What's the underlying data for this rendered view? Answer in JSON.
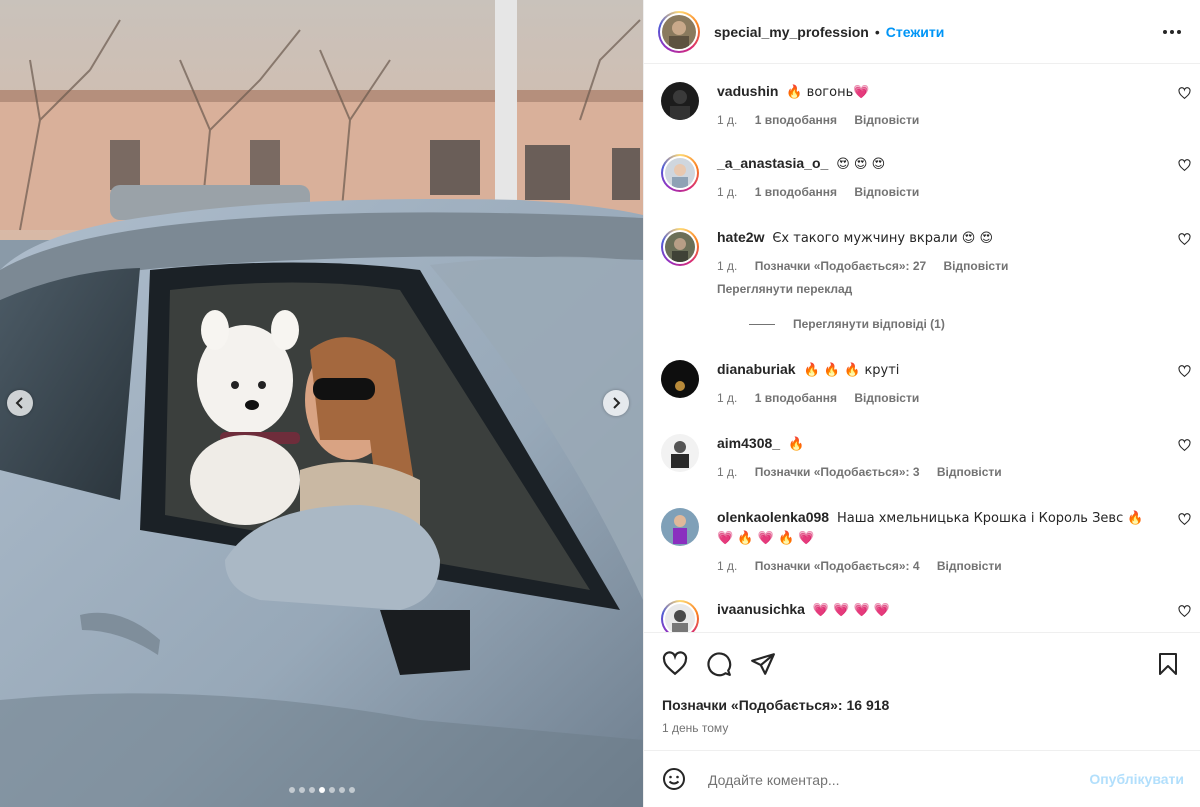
{
  "colors": {
    "accent": "#0095f6",
    "muted": "#737373",
    "text": "#262626",
    "post_disabled": "#b2dffc",
    "heart": "#ed4956"
  },
  "header": {
    "username": "special_my_profession",
    "separator": "•",
    "follow_label": "Стежити",
    "more_icon": "more-horizontal-icon"
  },
  "comments": [
    {
      "username": "vadushin",
      "text": "🔥 вогонь💗",
      "time": "1 д.",
      "likes": "1 вподобання",
      "reply": "Відповісти"
    },
    {
      "username": "_a_anastasia_o_",
      "text": "😍 😍 😍",
      "time": "1 д.",
      "likes": "1 вподобання",
      "reply": "Відповісти"
    },
    {
      "username": "hate2w",
      "text": "Єх такого мужчину вкрали 😍 😍",
      "time": "1 д.",
      "likes": "Позначки «Подобається»: 27",
      "reply": "Відповісти",
      "translate": "Переглянути переклад",
      "view_replies": "Переглянути відповіді (1)"
    },
    {
      "username": "dianaburiak",
      "text": "🔥 🔥 🔥 круті",
      "time": "1 д.",
      "likes": "1 вподобання",
      "reply": "Відповісти"
    },
    {
      "username": "aim4308_",
      "text": "🔥",
      "time": "1 д.",
      "likes": "Позначки «Подобається»: 3",
      "reply": "Відповісти"
    },
    {
      "username": "olenkaolenka098",
      "text": "Наша хмельницька Крошка і Король Зевс 🔥 💗 🔥 💗 🔥 💗",
      "time": "1 д.",
      "likes": "Позначки «Подобається»: 4",
      "reply": "Відповісти"
    },
    {
      "username": "ivaanusichka",
      "text": "💗 💗 💗 💗"
    }
  ],
  "footer": {
    "likes": "Позначки «Подобається»: 16 918",
    "time": "1 день тому",
    "comment_placeholder": "Додайте коментар...",
    "post_label": "Опублікувати"
  },
  "carousel": {
    "slide_count": 7,
    "active_index": 3
  }
}
